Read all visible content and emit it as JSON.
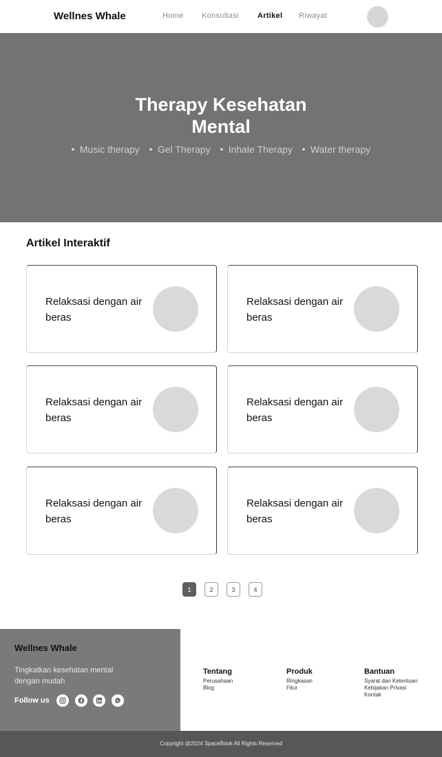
{
  "header": {
    "brand": "Wellnes Whale",
    "nav": [
      {
        "label": "Home"
      },
      {
        "label": "Konsultasi"
      },
      {
        "label": "Artikel"
      },
      {
        "label": "Riwayat"
      }
    ],
    "active_nav": "Artikel"
  },
  "hero": {
    "title_line1": "Therapy Kesehatan",
    "title_line2": "Mental",
    "tags": [
      "Music therapy",
      "Gel Therapy",
      "Inhale Therapy",
      "Water therapy"
    ]
  },
  "articles": {
    "title": "Artikel Interaktif",
    "cards": [
      {
        "title": "Relaksasi dengan air beras"
      },
      {
        "title": "Relaksasi dengan air beras"
      },
      {
        "title": "Relaksasi dengan air beras"
      },
      {
        "title": "Relaksasi dengan air beras"
      },
      {
        "title": "Relaksasi dengan air beras"
      },
      {
        "title": "Relaksasi dengan air beras"
      }
    ]
  },
  "pagination": {
    "pages": [
      "1",
      "2",
      "3",
      "4"
    ],
    "current": "1"
  },
  "footer": {
    "brand": "Wellnes Whale",
    "tagline": "Tingkatkan kesehatan mental dengan mudah",
    "follow_label": "Follow us",
    "social_icons": [
      "instagram-icon",
      "facebook-icon",
      "linkedin-icon",
      "whatsapp-icon"
    ],
    "columns": [
      {
        "title": "Tentang",
        "links": [
          "Perusahaan",
          "Blog"
        ]
      },
      {
        "title": "Produk",
        "links": [
          "Ringkasan",
          "Fitur"
        ]
      },
      {
        "title": "Bantuan",
        "links": [
          "Syarat dan Ketentuan",
          "Kebijakan Privasi",
          "Kontak"
        ]
      }
    ],
    "copyright": "Copyright @2024  SpaceBook All Rights Reserved"
  },
  "colors": {
    "hero_bg": "#737373",
    "footer_left_bg": "#7a7a7a",
    "copyright_bg": "#575757",
    "placeholder": "#d9d9d9"
  }
}
